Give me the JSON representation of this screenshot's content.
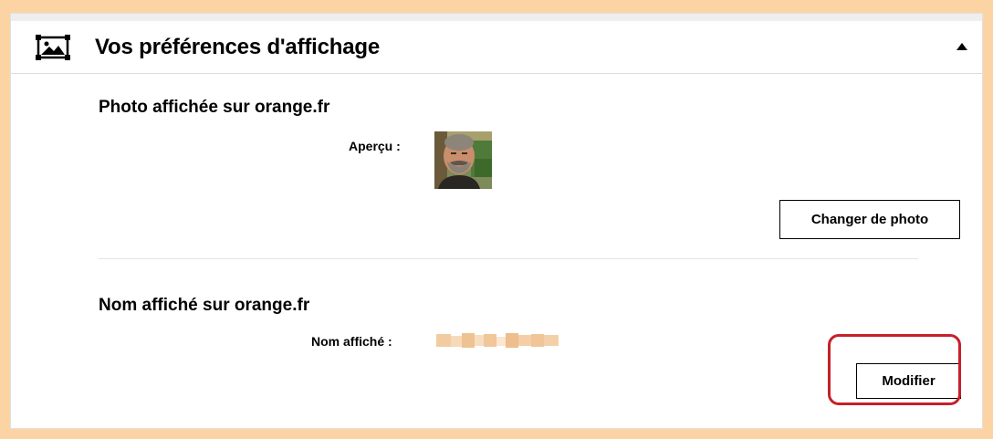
{
  "section": {
    "title": "Vos préférences d'affichage",
    "icon": "image-icon"
  },
  "photo": {
    "title": "Photo affichée sur orange.fr",
    "preview_label": "Aperçu :",
    "change_button": "Changer de photo"
  },
  "name": {
    "title": "Nom affiché sur orange.fr",
    "display_label": "Nom affiché :",
    "display_value": "",
    "edit_button": "Modifier"
  },
  "colors": {
    "page_background": "#fcd4a4",
    "highlight": "#c6202a"
  }
}
